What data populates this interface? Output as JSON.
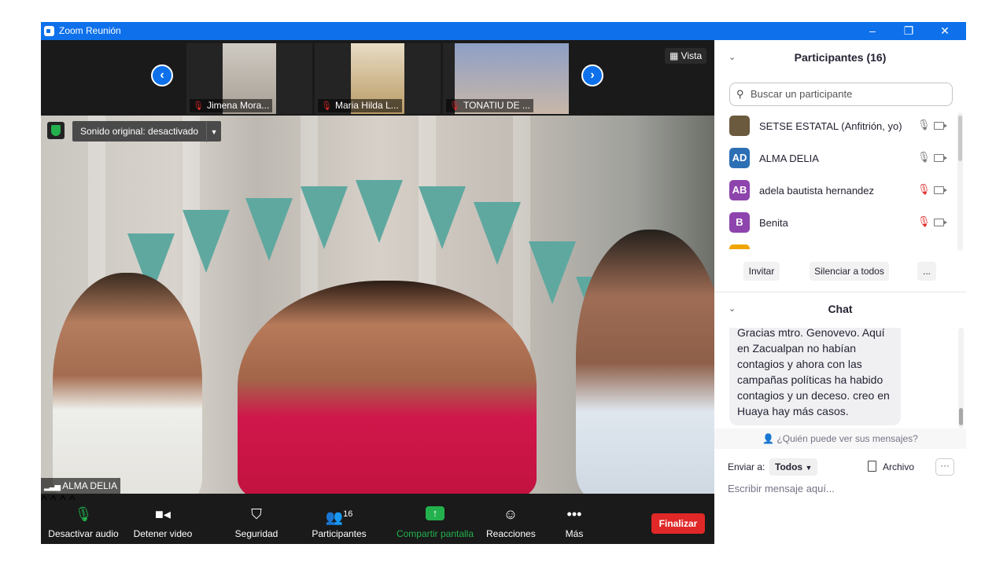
{
  "window": {
    "title": "Zoom Reunión"
  },
  "gallery": {
    "thumbnails": [
      {
        "name": "Jimena Mora..."
      },
      {
        "name": "Maria Hilda L..."
      },
      {
        "name": "TONATIU DE ..."
      }
    ],
    "view_label": "Vista"
  },
  "speaker": {
    "original_sound": "Sonido original: desactivado",
    "name": "ALMA DELIA"
  },
  "toolbar": {
    "mute_label": "Desactivar audio",
    "video_label": "Detener video",
    "security_label": "Seguridad",
    "participants_label": "Participantes",
    "participants_count": "16",
    "share_label": "Compartir pantalla",
    "reactions_label": "Reacciones",
    "more_label": "Más",
    "end_label": "Finalizar"
  },
  "participants": {
    "header": "Participantes (16)",
    "search_placeholder": "Buscar un participante",
    "list": [
      {
        "initials": "",
        "name": "SETSE ESTATAL (Anfitrión, yo)",
        "color": "#6b5a3e",
        "muted": false
      },
      {
        "initials": "AD",
        "name": "ALMA DELIA",
        "color": "#2d6fb5",
        "muted": false
      },
      {
        "initials": "AB",
        "name": "adela bautista hernandez",
        "color": "#8e44ad",
        "muted": true
      },
      {
        "initials": "B",
        "name": "Benita",
        "color": "#8e44ad",
        "muted": true
      }
    ],
    "invite_label": "Invitar",
    "mute_all_label": "Silenciar a todos",
    "more_label": "..."
  },
  "chat": {
    "header": "Chat",
    "message": "Gracias mtro. Genovevo. Aquí en Zacualpan no habían contagios y ahora con las campañas políticas ha habido contagios y un deceso. creo en Huaya hay más casos.",
    "who_can_see": "¿Quién puede ver sus mensajes?",
    "send_to_label": "Enviar a:",
    "send_to_value": "Todos",
    "file_label": "Archivo",
    "input_placeholder": "Escribir mensaje aquí..."
  },
  "colors": {
    "accent": "#0e71eb",
    "end": "#e02828",
    "secure": "#23b14d"
  }
}
